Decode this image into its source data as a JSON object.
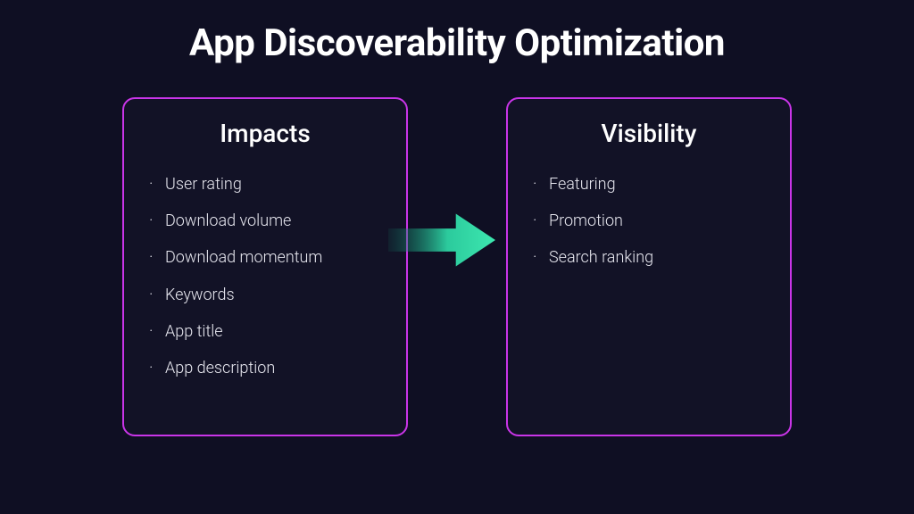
{
  "title": "App Discoverability Optimization",
  "cards": {
    "left": {
      "title": "Impacts",
      "items": [
        "User rating",
        "Download volume",
        "Download momentum",
        "Keywords",
        "App title",
        "App description"
      ]
    },
    "right": {
      "title": "Visibility",
      "items": [
        "Featuring",
        "Promotion",
        "Search ranking"
      ]
    }
  },
  "colors": {
    "background": "#0f0f23",
    "border": "#c935e8",
    "arrowStart": "#0f6b5a",
    "arrowEnd": "#3de8b0"
  }
}
